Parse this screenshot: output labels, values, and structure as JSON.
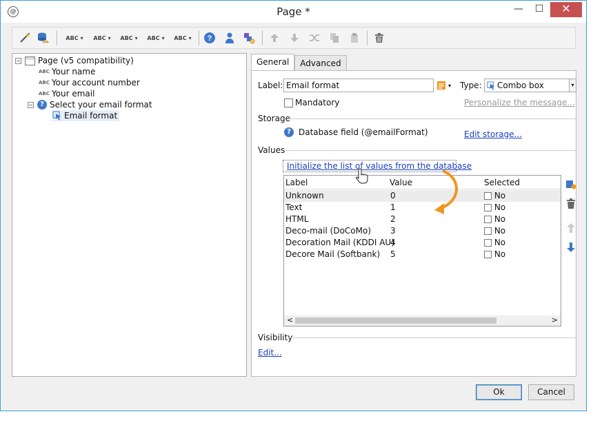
{
  "window": {
    "title": "Page *",
    "app_icon": "@",
    "minimize_glyph": "—",
    "maximize_glyph": "☐",
    "close_glyph": "✕"
  },
  "toolbar": {
    "abc_label": "ABC",
    "dropdown_glyph": "▾",
    "icons": [
      "magic-wand-icon",
      "database-link-icon",
      "help-icon",
      "person-icon",
      "add-shapes-icon",
      "move-up-icon",
      "move-down-icon",
      "shuffle-icon",
      "copy-icon",
      "paste-icon",
      "delete-icon"
    ]
  },
  "tree": {
    "items": [
      {
        "label": "Page (v5 compatibility)",
        "expander": "−"
      },
      {
        "label": "Your name",
        "prefix": "ABC"
      },
      {
        "label": "Your account number",
        "prefix": "ABC"
      },
      {
        "label": "Your email",
        "prefix": "ABC"
      },
      {
        "label": "Select your email format",
        "expander": "−",
        "icon": "?"
      },
      {
        "label": "Email format"
      }
    ]
  },
  "tabs": [
    {
      "label": "General",
      "active": true
    },
    {
      "label": "Advanced",
      "active": false
    }
  ],
  "general": {
    "label_caption": "Label:",
    "label_value": "Email format",
    "type_caption": "Type:",
    "type_value": "Combo box",
    "mandatory_label": "Mandatory",
    "mandatory_checked": false,
    "personalize_link": "Personalize the message...",
    "storage_heading": "Storage",
    "storage_value": "Database field (@emailFormat)",
    "edit_storage_link": "Edit storage...",
    "values_heading": "Values",
    "init_link": "Initialize the list of values from the database",
    "visibility_heading": "Visibility",
    "visibility_edit_link": "Edit..."
  },
  "values_table": {
    "columns": [
      "Label",
      "Value",
      "Selected"
    ],
    "rows": [
      {
        "label": "Unknown",
        "value": "0",
        "selected": "No"
      },
      {
        "label": "Text",
        "value": "1",
        "selected": "No"
      },
      {
        "label": "HTML",
        "value": "2",
        "selected": "No"
      },
      {
        "label": "Deco-mail (DoCoMo)",
        "value": "3",
        "selected": "No"
      },
      {
        "label": "Decoration Mail (KDDI AU)",
        "value": "4",
        "selected": "No"
      },
      {
        "label": "Decore Mail (Softbank)",
        "value": "5",
        "selected": "No"
      }
    ],
    "scroll_left": "<",
    "scroll_right": ">"
  },
  "side_buttons": [
    "add-value-icon",
    "delete-value-icon",
    "move-up-icon",
    "move-down-icon"
  ],
  "footer": {
    "ok_label": "Ok",
    "cancel_label": "Cancel"
  },
  "colors": {
    "accent_orange": "#f0961e",
    "link_blue": "#1a3fbf",
    "window_border": "#3aa0d6",
    "close_red": "#c75050"
  }
}
